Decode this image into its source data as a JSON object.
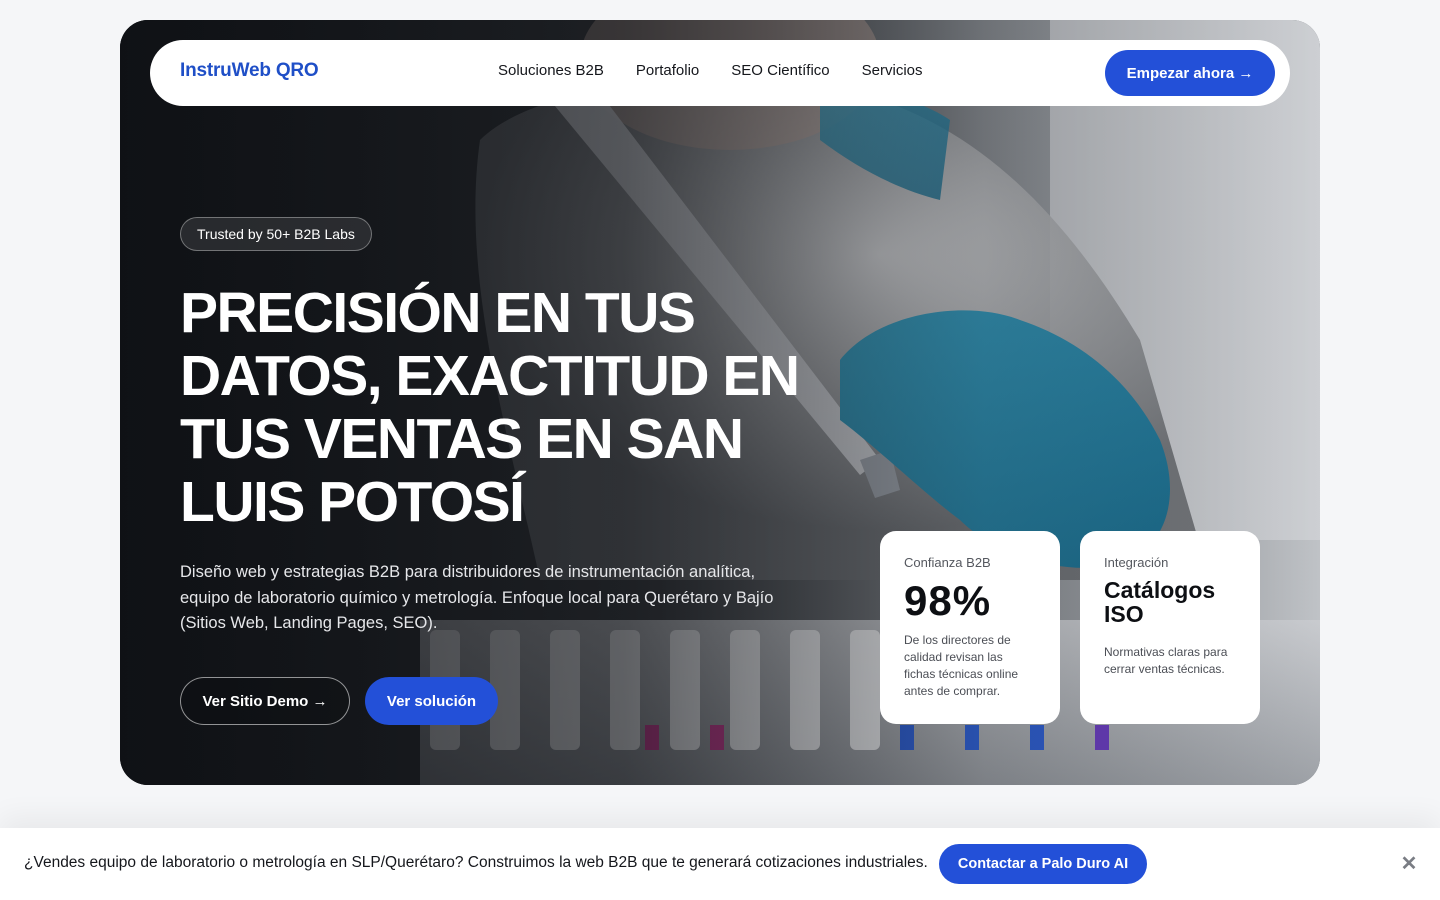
{
  "nav": {
    "brand": "InstruWeb QRO",
    "links": [
      "Soluciones B2B",
      "Portafolio",
      "SEO Científico",
      "Servicios"
    ],
    "cta": "Empezar ahora →"
  },
  "hero": {
    "badge": "Trusted by 50+ B2B Labs",
    "headline": "PRECISIÓN EN TUS DATOS, EXACTITUD EN TUS VENTAS EN SAN LUIS POTOSÍ",
    "subtext": "Diseño web y estrategias B2B para distribuidores de instrumentación analítica, equipo de laboratorio químico y metrología. Enfoque local para Querétaro y Bajío (Sitios Web, Landing Pages, SEO).",
    "btn_demo": "Ver Sitio Demo →",
    "btn_solution": "Ver solución",
    "background_image": "laboratory-pipette-photo"
  },
  "stats": [
    {
      "label": "Confianza B2B",
      "value": "98%",
      "desc": "De los directores de calidad revisan las fichas técnicas online antes de comprar."
    },
    {
      "label": "Integración",
      "value": "Catálogos ISO",
      "desc": "Normativas claras para cerrar ventas técnicas."
    }
  ],
  "banner": {
    "text": "¿Vendes equipo de laboratorio o metrología en SLP/Querétaro? Construimos la web B2B que te generará cotizaciones industriales.",
    "cta": "Contactar a Palo Duro AI",
    "close_icon": "close-icon"
  },
  "colors": {
    "accent": "#2350d8",
    "brand": "#1f4fc7",
    "page_bg": "#f5f6f8"
  }
}
